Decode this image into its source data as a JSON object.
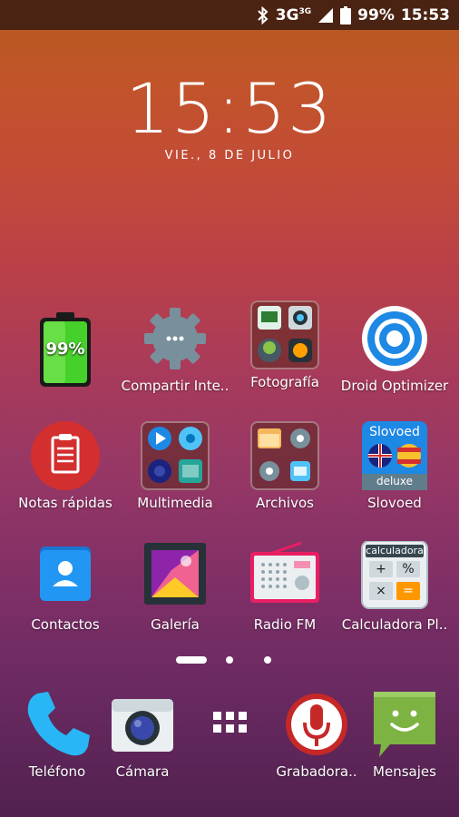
{
  "status_bar": {
    "network_type": "3G",
    "network_sup": "3G",
    "battery_percent": "99%",
    "time": "15:53"
  },
  "clock_widget": {
    "time": "15:53",
    "date": "VIE., 8 DE JULIO"
  },
  "apps": {
    "battery": {
      "badge": "99%"
    },
    "compartir": {
      "label": "Compartir Inte.."
    },
    "fotografia": {
      "label": "Fotografía"
    },
    "droid_optimizer": {
      "label": "Droid Optimizer"
    },
    "notas": {
      "label": "Notas rápidas"
    },
    "multimedia": {
      "label": "Multimedia"
    },
    "archivos": {
      "label": "Archivos"
    },
    "slovoed": {
      "label": "Slovoed",
      "top_text": "Slovoed",
      "bottom_text": "deluxe"
    },
    "contactos": {
      "label": "Contactos"
    },
    "galeria": {
      "label": "Galería"
    },
    "radio": {
      "label": "Radio FM"
    },
    "calculadora": {
      "label": "Calculadora Pl..",
      "header": "calculadora",
      "keys": [
        "+",
        "%",
        "×",
        "="
      ]
    }
  },
  "dock": {
    "telefono": {
      "label": "Teléfono"
    },
    "camara": {
      "label": "Cámara"
    },
    "grabadora": {
      "label": "Grabadora.."
    },
    "mensajes": {
      "label": "Mensajes"
    }
  },
  "page_indicator": {
    "pages": 3,
    "active": 1
  },
  "colors": {
    "status_bar_bg": "#4a2312",
    "accent_blue": "#1e88e5",
    "battery_green": "#46d02b"
  }
}
